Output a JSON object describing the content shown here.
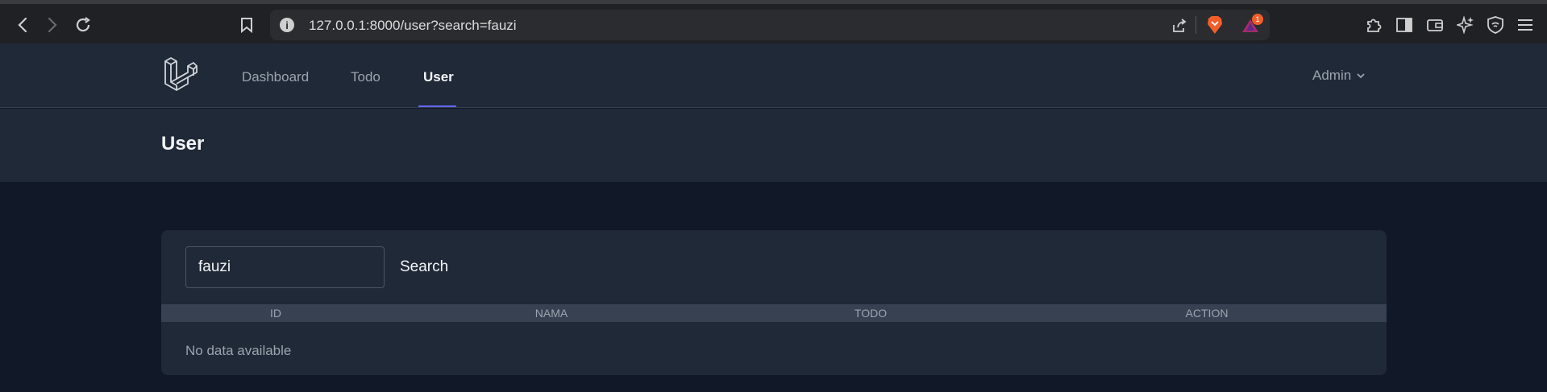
{
  "browser": {
    "url": "127.0.0.1:8000/user?search=fauzi",
    "notification_count": "1"
  },
  "nav": {
    "links": [
      "Dashboard",
      "Todo",
      "User"
    ],
    "user_menu": "Admin"
  },
  "header": {
    "title": "User"
  },
  "search": {
    "value": "fauzi",
    "button_label": "Search"
  },
  "table": {
    "columns": [
      "ID",
      "NAMA",
      "TODO",
      "ACTION"
    ],
    "empty_message": "No data available"
  },
  "colors": {
    "accent": "#6366f1",
    "brave_orange": "#f25e2a"
  }
}
